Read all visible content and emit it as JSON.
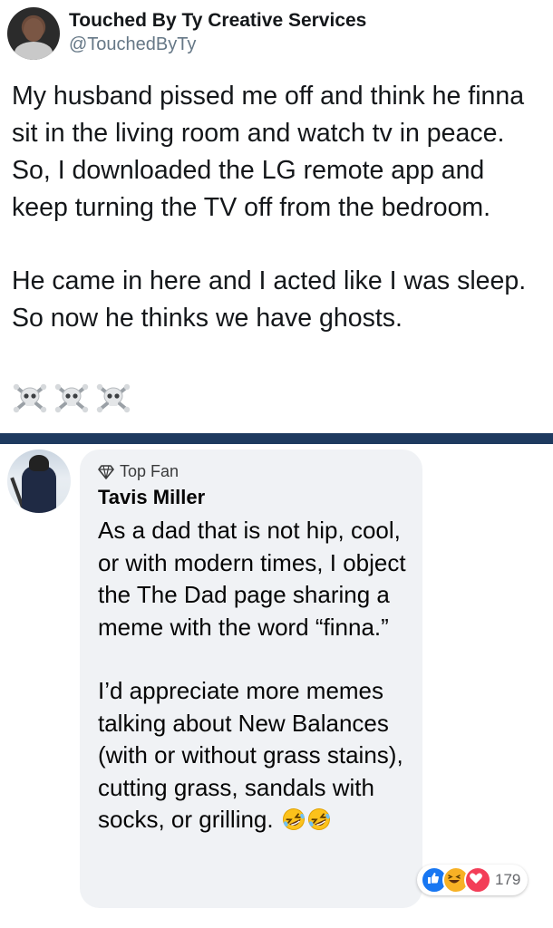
{
  "tweet": {
    "display_name": "Touched By Ty Creative Services",
    "handle": "@TouchedByTy",
    "paragraph_1": "My husband pissed me off and think he finna sit in the living room and watch tv in peace. So, I downloaded the LG remote app and keep turning the TV off from the bedroom.",
    "paragraph_2": "He came in here and I acted like I was sleep. So now he thinks we have ghosts.",
    "emojis": [
      "skull-crossbones-icon",
      "skull-crossbones-icon",
      "skull-crossbones-icon"
    ]
  },
  "divider_color": "#1e3a5f",
  "comment": {
    "badge": "Top Fan",
    "author": "Tavis Miller",
    "paragraph_1": "As a dad that is not hip, cool, or with modern times, I object the The Dad page sharing a meme with the word “finna.”",
    "paragraph_2": "I’d appreciate more memes talking about New Balances (with or without grass stains), cutting grass, sandals with socks, or grilling.",
    "trailing_emojis": [
      "rolling-on-floor-laughing-icon",
      "rolling-on-floor-laughing-icon"
    ],
    "reactions": {
      "types": [
        "like-icon",
        "haha-icon",
        "love-icon"
      ],
      "count": "179",
      "colors": {
        "like": "#1877f2",
        "haha": "#f7b125",
        "love": "#f33e58"
      }
    }
  }
}
